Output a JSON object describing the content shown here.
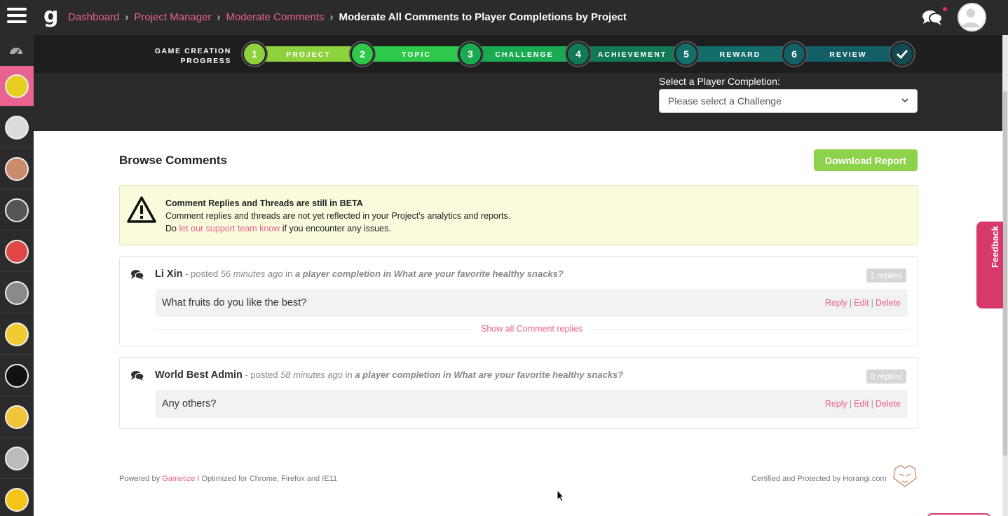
{
  "header": {
    "logo": "g",
    "breadcrumb": [
      {
        "label": "Dashboard"
      },
      {
        "label": "Project Manager"
      },
      {
        "label": "Moderate Comments"
      }
    ],
    "current_page": "Moderate All Comments to Player Completions by Project",
    "icons": [
      "menu-icon",
      "chat-icon",
      "avatar"
    ],
    "notification_dot_color": "#e0324b"
  },
  "sidebar": {
    "top_icon": "dashboard-gauge-icon",
    "items": [
      {
        "name": "project-corn",
        "color": "#e5d020",
        "active": true
      },
      {
        "name": "project-ink",
        "color": "#dcdcdc"
      },
      {
        "name": "project-gavel",
        "color": "#c98b6a"
      },
      {
        "name": "project-tape",
        "color": "#555555"
      },
      {
        "name": "project-pokeball",
        "color": "#e04848"
      },
      {
        "name": "project-city",
        "color": "#8a8a8a"
      },
      {
        "name": "project-pacman",
        "color": "#f0cc30"
      },
      {
        "name": "project-gametize",
        "color": "#111111"
      },
      {
        "name": "project-burger",
        "color": "#f2c438"
      },
      {
        "name": "project-group",
        "color": "#bbbbbb"
      },
      {
        "name": "project-people",
        "color": "#f5c518"
      }
    ]
  },
  "progress": {
    "label": "GAME CREATION PROGRESS",
    "steps": [
      {
        "num": "1",
        "label": "PROJECT",
        "color": "#8ed23d"
      },
      {
        "num": "2",
        "label": "TOPIC",
        "color": "#2ec94a"
      },
      {
        "num": "3",
        "label": "CHALLENGE",
        "color": "#1aab52"
      },
      {
        "num": "4",
        "label": "ACHIEVEMENT",
        "color": "#117a55"
      },
      {
        "num": "5",
        "label": "REWARD",
        "color": "#126d6b"
      },
      {
        "num": "6",
        "label": "REVIEW",
        "color": "#135f68"
      }
    ],
    "final_icon": "checkmark-icon",
    "final_color": "#134a52"
  },
  "filter": {
    "label": "Select a Player Completion:",
    "selected": "Please select a Challenge"
  },
  "main": {
    "title": "Browse Comments",
    "download_label": "Download Report",
    "download_color": "#8cd24a"
  },
  "beta_notice": {
    "heading": "Comment Replies and Threads are still in BETA",
    "line2": "Comment replies and threads are not yet reflected in your Project's analytics and reports.",
    "line3_prefix": "Do ",
    "line3_link": "let our support team know",
    "line3_suffix": " if you encounter any issues."
  },
  "comments": [
    {
      "author": "Li Xin",
      "posted_prefix": " - posted ",
      "time": "56 minutes ago",
      "in": " in ",
      "context": "a player completion in What are your favorite healthy snacks?",
      "replies": "1 replies",
      "message": "What fruits do you like the best?",
      "actions": [
        "Reply",
        "Edit",
        "Delete"
      ],
      "show_all": "Show all Comment replies"
    },
    {
      "author": "World Best Admin",
      "posted_prefix": " - posted ",
      "time": "58 minutes ago",
      "in": " in ",
      "context": "a player completion in What are your favorite healthy snacks?",
      "replies": "0 replies",
      "message": "Any others?",
      "actions": [
        "Reply",
        "Edit",
        "Delete"
      ]
    }
  ],
  "feedback": {
    "label": "Feedback",
    "color": "#d63a6b"
  },
  "footer": {
    "powered_prefix": "Powered by ",
    "powered_link": "Gametize",
    "powered_suffix": " I Optimized for Chrome, Firefox and IE11",
    "certified": "Certified and Protected by Horangi.com"
  },
  "colors": {
    "accent": "#e8638f",
    "dark": "#2b2b2b"
  }
}
